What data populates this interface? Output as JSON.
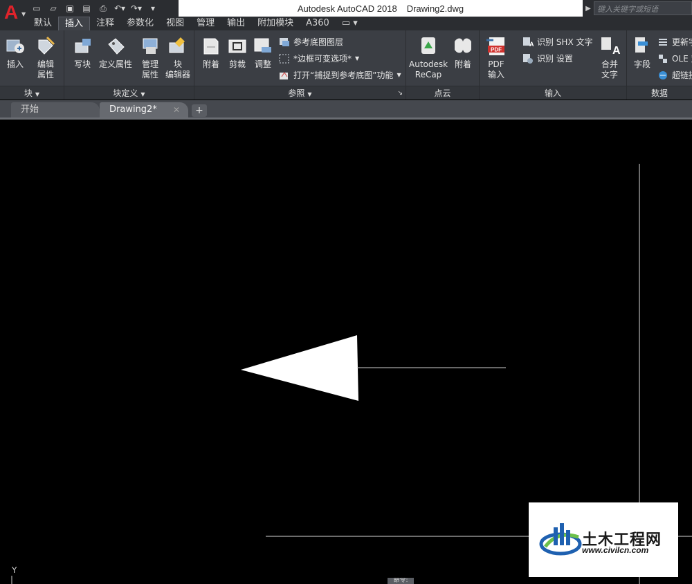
{
  "app": {
    "logo_letter": "A",
    "title": "Autodesk AutoCAD 2018",
    "document": "Drawing2.dwg",
    "search_placeholder": "键入关键字或短语"
  },
  "quick_access": [
    "new-icon",
    "open-icon",
    "save-icon",
    "save-as-icon",
    "print-icon",
    "undo-icon",
    "redo-icon",
    "customize-icon"
  ],
  "menu_tabs": [
    {
      "label": "默认"
    },
    {
      "label": "插入",
      "active": true
    },
    {
      "label": "注释"
    },
    {
      "label": "参数化"
    },
    {
      "label": "视图"
    },
    {
      "label": "管理"
    },
    {
      "label": "输出"
    },
    {
      "label": "附加模块"
    },
    {
      "label": "A360"
    },
    {
      "label": "▭ ▾"
    }
  ],
  "ribbon": {
    "block_panel": {
      "title": "块",
      "buttons": [
        "插入",
        "编辑",
        "属性"
      ]
    },
    "block_def_panel": {
      "title": "块定义",
      "buttons": [
        "写块",
        "定义属性",
        "管理",
        "属性",
        "块",
        "编辑器"
      ]
    },
    "reference_panel": {
      "title": "参照",
      "buttons": [
        "附着",
        "剪裁",
        "调整"
      ],
      "small": [
        "参考底图图层",
        "*边框可变选项*",
        "打开“捕捉到参考底图”功能"
      ]
    },
    "pointcloud_panel": {
      "title": "点云",
      "buttons": [
        "Autodesk",
        "ReCap",
        "附着"
      ]
    },
    "import_panel": {
      "title": "输入",
      "pdf": "PDF",
      "pdf_sub": "输入",
      "small": [
        "识别 SHX 文字",
        "识别 设置"
      ],
      "merge": [
        "合并",
        "文字"
      ]
    },
    "data_panel": {
      "title": "数据",
      "buttons": [
        "字段"
      ],
      "small": [
        "更新字",
        "OLE 对",
        "超链接"
      ]
    }
  },
  "doc_tabs": [
    {
      "label": "开始"
    },
    {
      "label": "Drawing2*",
      "active": true,
      "close": "✕"
    }
  ],
  "new_tab": "+",
  "command_line": "命令:",
  "ucs_label": "Y",
  "watermark": {
    "name": "土木工程网",
    "url": "www.civilcn.com"
  },
  "colors": {
    "title_bg": "#2b2d31",
    "ribbon_bg": "#3b3e44",
    "canvas_bg": "#000000",
    "accent": "#e0232b"
  }
}
